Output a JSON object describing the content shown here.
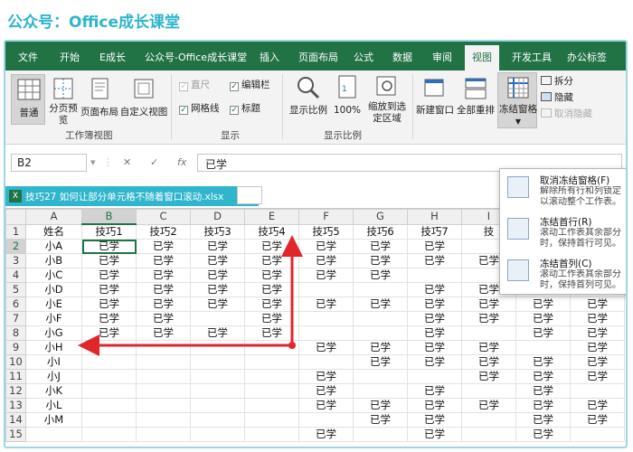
{
  "banner": {
    "title": "公众号：Office成长课堂"
  },
  "tabs": [
    "文件",
    "开始",
    "E成长",
    "公众号-Office成长课堂",
    "插入",
    "页面布局",
    "公式",
    "数据",
    "审阅",
    "视图",
    "开发工具",
    "办公标签"
  ],
  "active_tab": "视图",
  "ribbon": {
    "views": {
      "normal": "普通",
      "page_break": "分页预览",
      "page_layout": "页面布局",
      "custom": "自定义视图",
      "group": "工作簿视图"
    },
    "show": {
      "ruler": "直尺",
      "formula_bar": "编辑栏",
      "gridlines": "网格线",
      "headings": "标题",
      "group": "显示"
    },
    "zoom": {
      "zoom": "显示比例",
      "hundred": "100%",
      "selection": "缩放到选定区域",
      "group": "显示比例"
    },
    "window": {
      "new_window": "新建窗口",
      "arrange_all": "全部重排",
      "freeze_panes": "冻结窗格",
      "split": "拆分",
      "hide": "隐藏",
      "unhide": "取消隐藏"
    }
  },
  "formula": {
    "cell_ref": "B2",
    "cancel": "✕",
    "enter": "✓",
    "fx": "fx",
    "value": "已学"
  },
  "doc_tab": {
    "name": "技巧27  如何让部分单元格不随着窗口滚动.xlsx",
    "icon": "X"
  },
  "freeze_menu": {
    "items": [
      {
        "title": "取消冻结窗格(F)",
        "desc1": "解除所有行和列锁定",
        "desc2": "以滚动整个工作表。"
      },
      {
        "title": "冻结首行(R)",
        "desc1": "滚动工作表其余部分",
        "desc2": "时，保持首行可见。"
      },
      {
        "title": "冻结首列(C)",
        "desc1": "滚动工作表其余部分",
        "desc2": "时，保持首列可见。"
      }
    ]
  },
  "sheet": {
    "columns": [
      "A",
      "B",
      "C",
      "D",
      "E",
      "F",
      "G",
      "H",
      "I",
      "J",
      "K"
    ],
    "rows": [
      {
        "n": "1",
        "cells": [
          "姓名",
          "技巧1",
          "技巧2",
          "技巧3",
          "技巧4",
          "技巧5",
          "技巧6",
          "技巧7",
          "技",
          "",
          ""
        ]
      },
      {
        "n": "2",
        "cells": [
          "小A",
          "已学",
          "已学",
          "已学",
          "已学",
          "已学",
          "已学",
          "已学",
          "",
          "",
          ""
        ]
      },
      {
        "n": "3",
        "cells": [
          "小B",
          "已学",
          "已学",
          "已学",
          "已学",
          "已学",
          "已学",
          "已学",
          "已学",
          "已学",
          "已学"
        ]
      },
      {
        "n": "4",
        "cells": [
          "小C",
          "已学",
          "已学",
          "已学",
          "已学",
          "已学",
          "已学",
          "",
          "",
          "已学",
          "已学"
        ]
      },
      {
        "n": "5",
        "cells": [
          "小D",
          "已学",
          "已学",
          "已学",
          "已学",
          "",
          "",
          "已学",
          "已学",
          "已学",
          "已学"
        ]
      },
      {
        "n": "6",
        "cells": [
          "小E",
          "已学",
          "已学",
          "已学",
          "已学",
          "已学",
          "已学",
          "已学",
          "已学",
          "已学",
          "已学"
        ]
      },
      {
        "n": "7",
        "cells": [
          "小F",
          "已学",
          "已学",
          "",
          "已学",
          "",
          "",
          "已学",
          "已学",
          "已学",
          "已学"
        ]
      },
      {
        "n": "8",
        "cells": [
          "小G",
          "已学",
          "已学",
          "已学",
          "已学",
          "",
          "",
          "已学",
          "",
          "已学",
          "已学"
        ]
      },
      {
        "n": "9",
        "cells": [
          "小H",
          "",
          "",
          "",
          "",
          "已学",
          "已学",
          "已学",
          "已学",
          "",
          "已学"
        ]
      },
      {
        "n": "10",
        "cells": [
          "小I",
          "",
          "",
          "",
          "",
          "",
          "已学",
          "已学",
          "已学",
          "已学",
          "已学"
        ]
      },
      {
        "n": "11",
        "cells": [
          "小J",
          "",
          "",
          "",
          "",
          "已学",
          "",
          "",
          "已学",
          "已学",
          "已学"
        ]
      },
      {
        "n": "12",
        "cells": [
          "小K",
          "",
          "",
          "",
          "",
          "已学",
          "",
          "已学",
          "",
          "已学",
          ""
        ]
      },
      {
        "n": "13",
        "cells": [
          "小L",
          "",
          "",
          "",
          "",
          "已学",
          "已学",
          "已学",
          "已学",
          "已学",
          "已学"
        ]
      },
      {
        "n": "14",
        "cells": [
          "小M",
          "",
          "",
          "",
          "",
          "",
          "已学",
          "已学",
          "",
          "已学",
          "已学"
        ]
      },
      {
        "n": "15",
        "cells": [
          "",
          "",
          "",
          "",
          "",
          "已学",
          "",
          "已学",
          "",
          "已学",
          ""
        ]
      }
    ]
  },
  "colors": {
    "excel_green": "#217346",
    "banner": "#2fb5cc",
    "arrow": "#e0262b"
  }
}
